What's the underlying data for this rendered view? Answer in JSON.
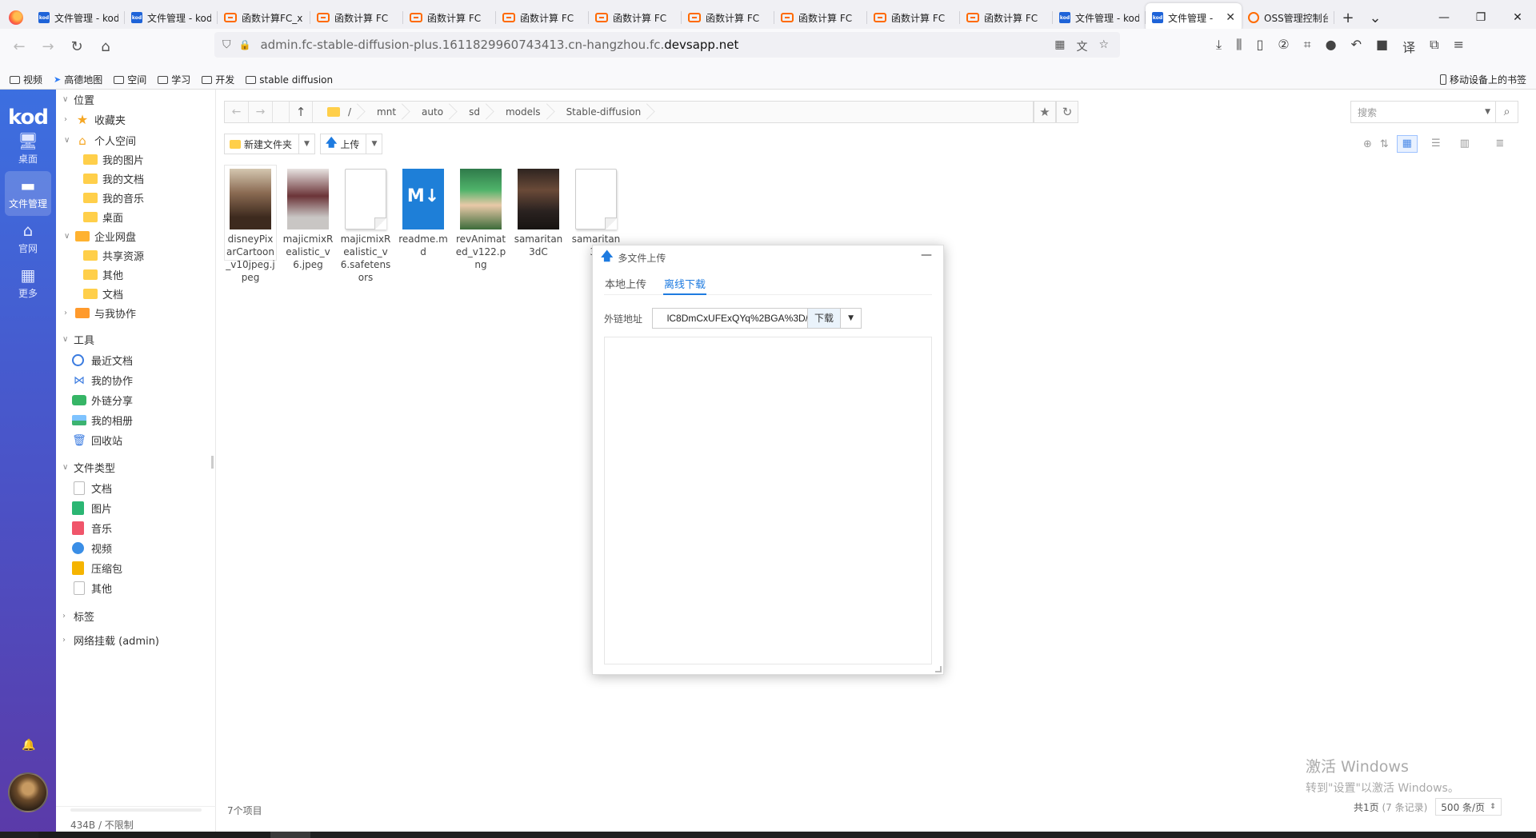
{
  "browser": {
    "tabs": [
      {
        "icon": "kod",
        "label": "文件管理 - kod"
      },
      {
        "icon": "kod",
        "label": "文件管理 - kod"
      },
      {
        "icon": "fc",
        "label": "函数计算FC_x"
      },
      {
        "icon": "fc",
        "label": "函数计算 FC"
      },
      {
        "icon": "fc",
        "label": "函数计算 FC"
      },
      {
        "icon": "fc",
        "label": "函数计算 FC"
      },
      {
        "icon": "fc",
        "label": "函数计算 FC"
      },
      {
        "icon": "fc",
        "label": "函数计算 FC"
      },
      {
        "icon": "fc",
        "label": "函数计算 FC"
      },
      {
        "icon": "fc",
        "label": "函数计算 FC"
      },
      {
        "icon": "fc",
        "label": "函数计算 FC"
      },
      {
        "icon": "kod",
        "label": "文件管理 - kod"
      },
      {
        "icon": "kod",
        "label": "文件管理 -",
        "active": true
      },
      {
        "icon": "oss",
        "label": "OSS管理控制台"
      }
    ],
    "url_prefix": "admin.fc-stable-diffusion-plus.1611829960743413.cn-hangzhou.fc.",
    "url_domain": "devsapp.net",
    "bookmarks": [
      "视频",
      "高德地图",
      "空间",
      "学习",
      "开发",
      "stable diffusion"
    ],
    "mobile_bookmarks": "移动设备上的书签"
  },
  "rail": {
    "logo": "kod",
    "items": [
      {
        "icon": "desktop-icon",
        "label": "桌面"
      },
      {
        "icon": "folder-icon",
        "label": "文件管理"
      },
      {
        "icon": "home-icon",
        "label": "官网"
      },
      {
        "icon": "grid-icon",
        "label": "更多"
      }
    ]
  },
  "sidebar": {
    "section_location": "位置",
    "favorites": "收藏夹",
    "personal_space": "个人空间",
    "personal_items": [
      "我的图片",
      "我的文档",
      "我的音乐",
      "桌面"
    ],
    "enterprise_drive": "企业网盘",
    "enterprise_items": [
      "共享资源",
      "其他",
      "文档"
    ],
    "shared_with_me": "与我协作",
    "section_tools": "工具",
    "tool_items": [
      "最近文档",
      "我的协作",
      "外链分享",
      "我的相册",
      "回收站"
    ],
    "section_filetypes": "文件类型",
    "filetype_items": [
      "文档",
      "图片",
      "音乐",
      "视频",
      "压缩包",
      "其他"
    ],
    "section_tags": "标签",
    "section_network": "网络挂载 (admin)",
    "quota": "434B / 不限制"
  },
  "main": {
    "path": [
      "/",
      "mnt",
      "auto",
      "sd",
      "models",
      "Stable-diffusion"
    ],
    "search_placeholder": "搜索",
    "new_folder_label": "新建文件夹",
    "upload_label": "上传",
    "files": [
      {
        "name": "disneyPixarCartoon_v10jpeg.jpeg",
        "type": "image",
        "thumb": "img1"
      },
      {
        "name": "majicmixRealistic_v6.jpeg",
        "type": "image",
        "thumb": "img2"
      },
      {
        "name": "majicmixRealistic_v6.safetensors",
        "type": "file",
        "thumb": "blank"
      },
      {
        "name": "readme.md",
        "type": "markdown",
        "thumb": "md"
      },
      {
        "name": "revAnimated_v122.png",
        "type": "image",
        "thumb": "img3"
      },
      {
        "name": "samaritan3dC",
        "type": "image",
        "thumb": "img4"
      },
      {
        "name": "samaritan3d",
        "type": "file",
        "thumb": "blank"
      }
    ],
    "item_count": "7个项目",
    "pages": "共1页",
    "record_count": "(7 条记录)",
    "page_size": "500 条/页",
    "md_icon_text": "M↓"
  },
  "dialog": {
    "title": "多文件上传",
    "tabs": [
      "本地上传",
      "离线下载"
    ],
    "active_tab": 1,
    "url_label": "外链地址",
    "url_value": "/lC8DmCxUFExQYq%2BGA%3D",
    "download_label": "下载"
  },
  "watermark": {
    "line1": "激活 Windows",
    "line2": "转到\"设置\"以激活 Windows。"
  },
  "colors": {
    "accent": "#1e7be0",
    "rail_top": "#3c6fe0",
    "rail_bottom": "#5b3aa8",
    "folder": "#ffcf4a"
  }
}
